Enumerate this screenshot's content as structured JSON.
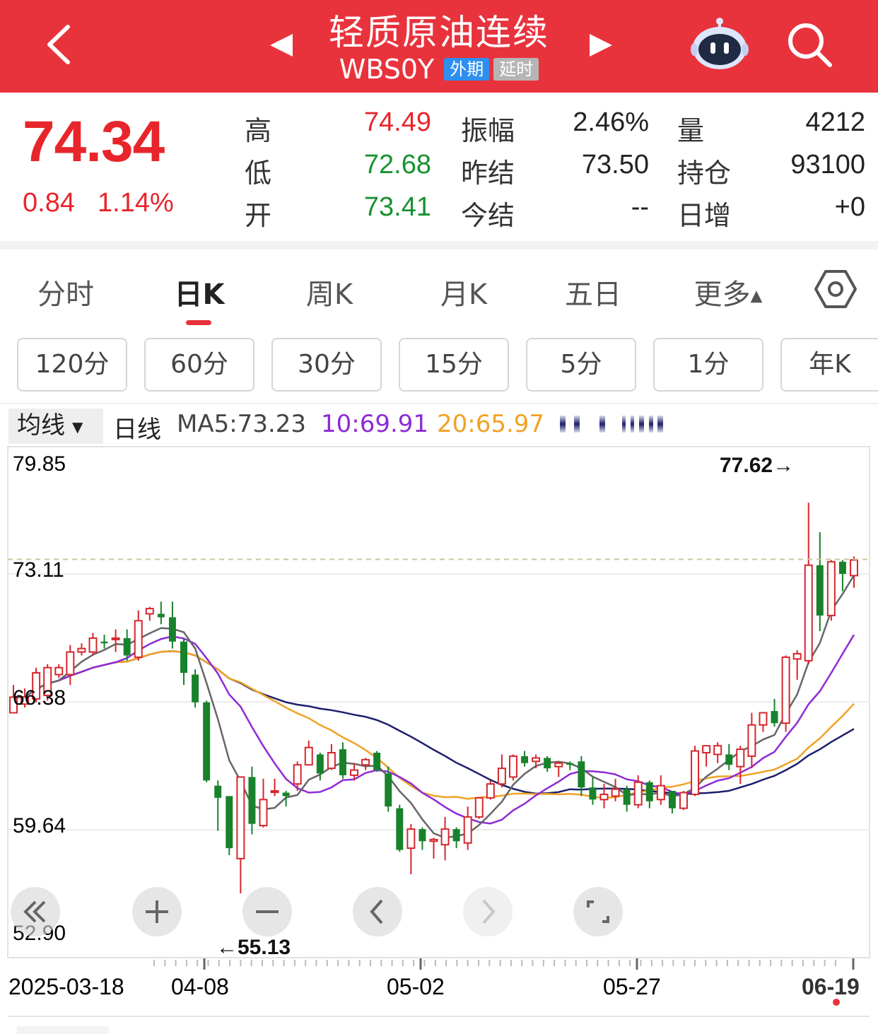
{
  "header": {
    "title": "轻质原油连续",
    "code": "WBS0Y",
    "tag_foreign": "外期",
    "tag_delayed": "延时",
    "bg_color": "#e8333d"
  },
  "quote": {
    "price": "74.34",
    "change": "0.84",
    "change_pct": "1.14%",
    "rows": [
      {
        "l1": "高",
        "v1": "74.49",
        "l2": "振幅",
        "v2": "2.46%",
        "l3": "量",
        "v3": "4212"
      },
      {
        "l1": "低",
        "v1": "72.68",
        "l2": "昨结",
        "v2": "73.50",
        "l3": "持仓",
        "v3": "93100"
      },
      {
        "l1": "开",
        "v1": "73.41",
        "l2": "今结",
        "v2": "--",
        "l3": "日增",
        "v3": "+0"
      }
    ]
  },
  "tabs": [
    "分时",
    "日K",
    "周K",
    "月K",
    "五日",
    "更多"
  ],
  "active_tab": "日K",
  "periods": [
    "120分",
    "60分",
    "30分",
    "15分",
    "5分",
    "1分",
    "年K"
  ],
  "ma_legend": {
    "button": "均线",
    "type": "日线",
    "ma5": "MA5:73.23",
    "ma10": "10:69.91",
    "ma20": "20:65.97"
  },
  "chart_data": {
    "type": "candlestick",
    "y_ticks": [
      "79.85",
      "73.11",
      "66.38",
      "59.64",
      "52.90"
    ],
    "y_range": [
      52.9,
      79.85
    ],
    "x_labels": [
      "2025-03-18",
      "04-08",
      "05-02",
      "05-27",
      "06-19"
    ],
    "max_label": "77.62→",
    "min_label": "←55.13",
    "current_line": 74.34,
    "candles": [
      [
        65.5,
        66.4,
        65.6,
        67.1
      ],
      [
        66.0,
        66.4,
        65.8,
        66.9
      ],
      [
        66.3,
        67.8,
        66.1,
        68.1
      ],
      [
        66.5,
        68.1,
        66.2,
        68.3
      ],
      [
        67.7,
        68.1,
        67.5,
        68.3
      ],
      [
        67.7,
        69.0,
        67.1,
        69.4
      ],
      [
        69.0,
        69.2,
        68.8,
        69.5
      ],
      [
        69.0,
        69.8,
        68.8,
        70.1
      ],
      [
        69.6,
        69.5,
        69.2,
        70.0
      ],
      [
        69.8,
        69.8,
        69.0,
        70.3
      ],
      [
        69.8,
        68.8,
        68.5,
        70.3
      ],
      [
        68.7,
        70.8,
        68.5,
        71.4
      ],
      [
        71.2,
        71.5,
        70.8,
        71.6
      ],
      [
        71.2,
        71.0,
        70.6,
        71.9
      ],
      [
        71.0,
        69.6,
        69.2,
        71.9
      ],
      [
        69.6,
        67.8,
        67.1,
        69.8
      ],
      [
        67.7,
        66.1,
        65.8,
        68.0
      ],
      [
        66.1,
        61.6,
        61.5,
        66.2
      ],
      [
        61.3,
        60.6,
        58.7,
        61.6
      ],
      [
        60.7,
        57.7,
        57.3,
        60.7
      ],
      [
        57.1,
        61.8,
        55.1,
        61.8
      ],
      [
        61.8,
        59.1,
        58.5,
        62.4
      ],
      [
        59.0,
        60.5,
        58.9,
        61.7
      ],
      [
        61.0,
        61.0,
        60.7,
        61.7
      ],
      [
        60.9,
        60.7,
        60.1,
        61.0
      ],
      [
        61.4,
        62.5,
        61.0,
        62.7
      ],
      [
        62.5,
        63.5,
        62.5,
        63.9
      ],
      [
        63.1,
        62.0,
        61.6,
        63.2
      ],
      [
        62.3,
        63.2,
        62.2,
        63.7
      ],
      [
        63.4,
        61.9,
        61.7,
        63.8
      ],
      [
        61.9,
        62.2,
        61.6,
        62.6
      ],
      [
        62.5,
        62.8,
        62.2,
        62.9
      ],
      [
        63.2,
        62.2,
        62.1,
        63.3
      ],
      [
        62.0,
        60.1,
        59.8,
        62.4
      ],
      [
        60.0,
        57.6,
        57.5,
        60.2
      ],
      [
        57.7,
        58.8,
        56.2,
        59.1
      ],
      [
        58.8,
        58.1,
        57.6,
        58.9
      ],
      [
        58.1,
        58.2,
        57.1,
        58.3
      ],
      [
        57.9,
        58.8,
        57.0,
        59.5
      ],
      [
        58.8,
        58.1,
        57.7,
        58.9
      ],
      [
        58.0,
        59.5,
        57.6,
        60.1
      ],
      [
        59.5,
        60.6,
        59.4,
        60.6
      ],
      [
        60.6,
        61.4,
        60.5,
        61.6
      ],
      [
        61.4,
        62.3,
        61.2,
        63.1
      ],
      [
        61.8,
        63.0,
        61.6,
        63.1
      ],
      [
        63.0,
        62.6,
        62.4,
        63.3
      ],
      [
        62.7,
        62.9,
        62.3,
        63.1
      ],
      [
        62.9,
        62.3,
        62.1,
        63.0
      ],
      [
        62.4,
        62.6,
        61.8,
        62.7
      ],
      [
        62.6,
        62.5,
        62.2,
        62.7
      ],
      [
        62.7,
        61.2,
        60.7,
        63.0
      ],
      [
        61.2,
        60.5,
        60.2,
        61.8
      ],
      [
        60.5,
        60.8,
        60.0,
        61.4
      ],
      [
        60.7,
        61.1,
        60.4,
        61.7
      ],
      [
        61.1,
        60.2,
        59.8,
        61.3
      ],
      [
        60.2,
        61.5,
        60.0,
        61.9
      ],
      [
        61.5,
        60.4,
        60.0,
        61.6
      ],
      [
        60.5,
        61.3,
        60.2,
        61.9
      ],
      [
        61.0,
        60.0,
        59.7,
        61.0
      ],
      [
        60.0,
        60.9,
        59.9,
        61.0
      ],
      [
        60.8,
        63.3,
        60.7,
        63.6
      ],
      [
        63.2,
        63.6,
        62.4,
        63.6
      ],
      [
        63.1,
        63.6,
        62.6,
        63.8
      ],
      [
        63.1,
        62.5,
        62.2,
        63.7
      ],
      [
        62.4,
        63.4,
        61.4,
        63.6
      ],
      [
        63.0,
        64.8,
        62.3,
        65.5
      ],
      [
        64.8,
        65.5,
        64.4,
        65.5
      ],
      [
        65.6,
        64.9,
        64.7,
        66.3
      ],
      [
        64.9,
        68.7,
        64.4,
        68.8
      ],
      [
        68.6,
        68.9,
        67.4,
        69.1
      ],
      [
        68.5,
        74.0,
        68.3,
        77.6
      ],
      [
        74.0,
        71.1,
        70.2,
        75.9
      ],
      [
        71.1,
        74.2,
        70.8,
        74.3
      ],
      [
        74.2,
        73.5,
        72.5,
        74.3
      ],
      [
        73.4,
        74.3,
        72.7,
        74.5
      ]
    ]
  },
  "ma_colors": {
    "ma5": "#666666",
    "ma10": "#8e2ad6",
    "ma20": "#f0a224",
    "ma30": "#1b1f6b"
  },
  "up_color": "#d6262c",
  "down_color": "#18822b"
}
